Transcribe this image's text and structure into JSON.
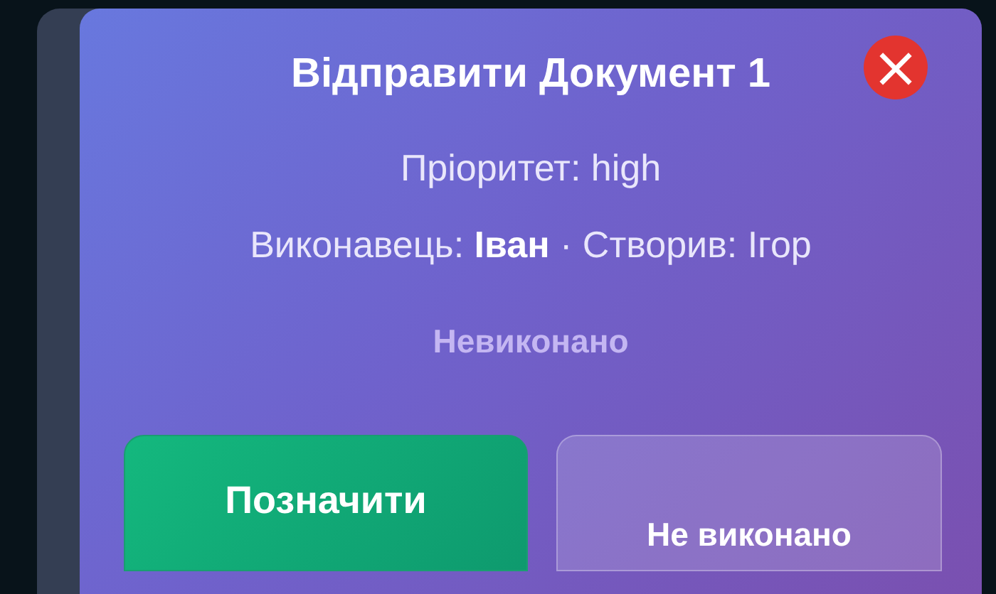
{
  "task": {
    "title": "Відправити Документ 1",
    "close_label": "×",
    "priority": "Пріоритет: high",
    "people": "Виконавець: **Іван** · Створив: Ігор",
    "status": "Невиконано"
  },
  "buttons": [
    {
      "label": "Позначити",
      "kind": "primary"
    },
    {
      "label": "Не виконано",
      "kind": "secondary"
    }
  ]
}
